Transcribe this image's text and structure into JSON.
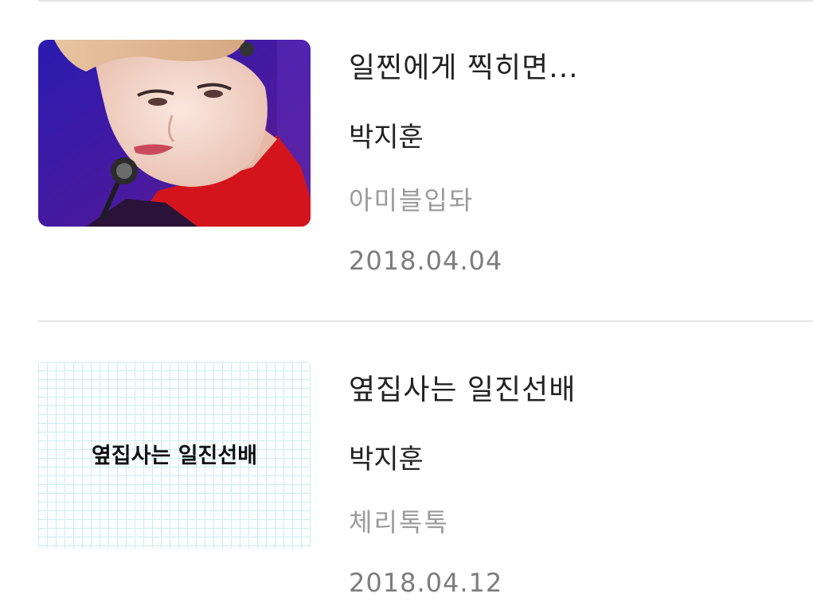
{
  "stories": [
    {
      "title": "일찐에게 찍히면...",
      "author": "박지훈",
      "group": "아미블입돠",
      "date": "2018.04.04",
      "thumbnail": "photo",
      "thumbnail_caption": ""
    },
    {
      "title": "옆집사는 일진선배",
      "author": "박지훈",
      "group": "체리톡톡",
      "date": "2018.04.12",
      "thumbnail": "grid-paper",
      "thumbnail_caption": "옆집사는 일진선배"
    }
  ],
  "colors": {
    "title": "#222222",
    "group": "#9a9a9a",
    "date": "#7d7d7d",
    "divider": "#e3e3e3",
    "thumb_background": "#4a1a9e",
    "sweater": "#d4141c"
  }
}
